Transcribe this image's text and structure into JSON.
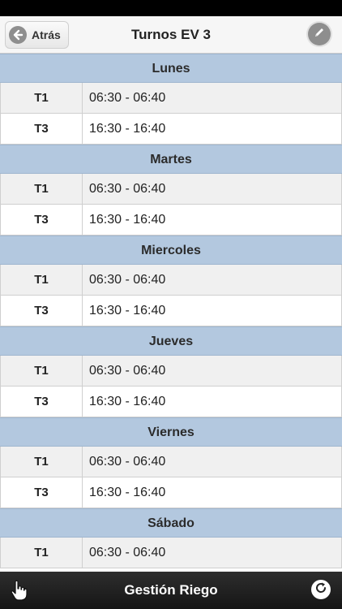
{
  "header": {
    "back_label": "Atrás",
    "title": "Turnos EV 3",
    "edit_icon": "pencil-icon",
    "back_icon": "arrow-left-icon"
  },
  "days": [
    {
      "name": "Lunes",
      "shifts": [
        {
          "turn": "T1",
          "time": "06:30 - 06:40"
        },
        {
          "turn": "T3",
          "time": "16:30 - 16:40"
        }
      ]
    },
    {
      "name": "Martes",
      "shifts": [
        {
          "turn": "T1",
          "time": "06:30 - 06:40"
        },
        {
          "turn": "T3",
          "time": "16:30 - 16:40"
        }
      ]
    },
    {
      "name": "Miercoles",
      "shifts": [
        {
          "turn": "T1",
          "time": "06:30 - 06:40"
        },
        {
          "turn": "T3",
          "time": "16:30 - 16:40"
        }
      ]
    },
    {
      "name": "Jueves",
      "shifts": [
        {
          "turn": "T1",
          "time": "06:30 - 06:40"
        },
        {
          "turn": "T3",
          "time": "16:30 - 16:40"
        }
      ]
    },
    {
      "name": "Viernes",
      "shifts": [
        {
          "turn": "T1",
          "time": "06:30 - 06:40"
        },
        {
          "turn": "T3",
          "time": "16:30 - 16:40"
        }
      ]
    },
    {
      "name": "Sábado",
      "shifts": [
        {
          "turn": "T1",
          "time": "06:30 - 06:40"
        }
      ]
    }
  ],
  "footer": {
    "title": "Gestión Riego",
    "left_icon": "hand-pointer-icon",
    "right_icon": "refresh-icon"
  },
  "colors": {
    "day_header_bg": "#b3c8df",
    "row_odd_bg": "#f0f0f0",
    "footer_bg": "#1e1e1e"
  }
}
